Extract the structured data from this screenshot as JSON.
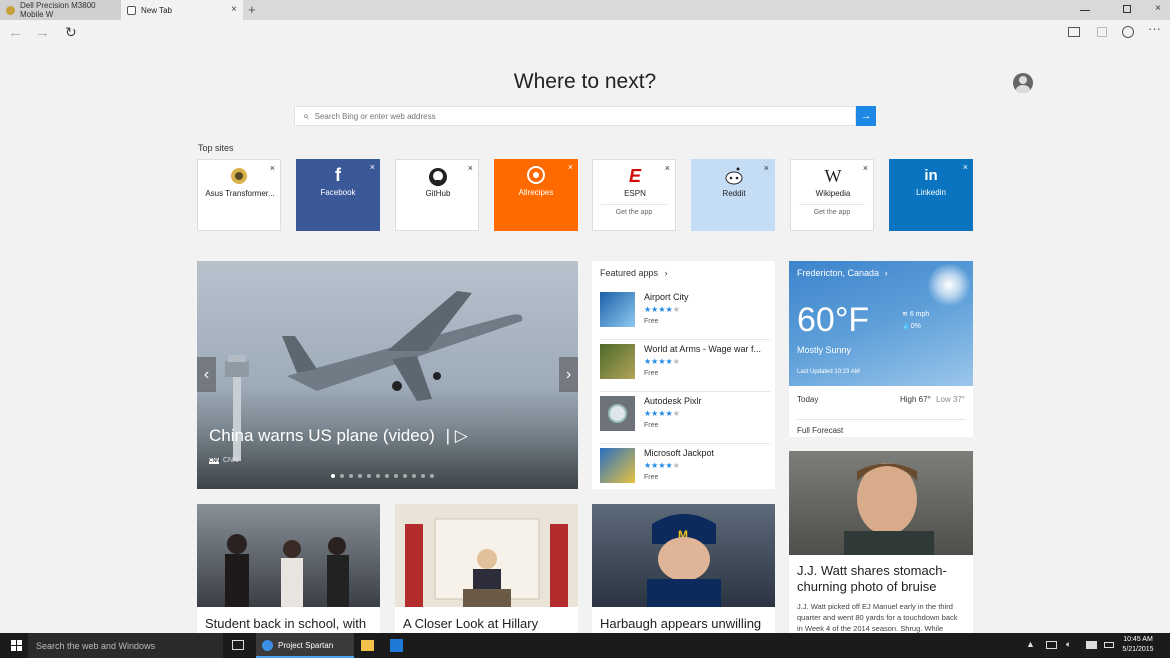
{
  "browser": {
    "tabs": [
      {
        "label": "Dell Precision M3800 Mobile W"
      },
      {
        "label": "New Tab"
      }
    ]
  },
  "icons": {
    "close": "×",
    "plus": "+",
    "back": "←",
    "forward": "→",
    "refresh": "↻",
    "search": "⌕",
    "go": "→",
    "prev": "‹",
    "next": "›",
    "chevron": "›",
    "play": "▷"
  },
  "newtab": {
    "headline": "Where to next?",
    "search_placeholder": "Search Bing or enter web address",
    "top_sites_label": "Top sites"
  },
  "top_sites": [
    {
      "name": "Asus Transformer...",
      "logo": "",
      "get_app": ""
    },
    {
      "name": "Facebook",
      "logo": "f",
      "get_app": ""
    },
    {
      "name": "GitHub",
      "logo": "",
      "get_app": ""
    },
    {
      "name": "Allrecipes",
      "logo": "",
      "get_app": ""
    },
    {
      "name": "ESPN",
      "logo": "E",
      "get_app": "Get the app"
    },
    {
      "name": "Reddit",
      "logo": "",
      "get_app": ""
    },
    {
      "name": "Wikipedia",
      "logo": "W",
      "get_app": "Get the app"
    },
    {
      "name": "Linkedin",
      "logo": "in",
      "get_app": ""
    }
  ],
  "colors": {
    "facebook": "#3b5998",
    "allrecipes": "#ff6a00",
    "reddit": "#c5dcf5",
    "linkedin": "#0a74c0",
    "accent": "#1e88e5",
    "espn": "#d50a0a"
  },
  "hero": {
    "caption": "China warns US plane (video)",
    "source_badge": "CNN",
    "source": "CNN"
  },
  "featured_apps": {
    "header": "Featured apps",
    "items": [
      {
        "name": "Airport City",
        "price": "Free",
        "rating": 4
      },
      {
        "name": "World at Arms - Wage war f...",
        "price": "Free",
        "rating": 4
      },
      {
        "name": "Autodesk Pixlr",
        "price": "Free",
        "rating": 4
      },
      {
        "name": "Microsoft Jackpot",
        "price": "Free",
        "rating": 4
      }
    ]
  },
  "weather": {
    "city": "Fredericton, Canada",
    "temp": "60°F",
    "condition": "Mostly Sunny",
    "wind": "6 mph",
    "precip": "0%",
    "updated": "Last Updated 10:23 AM",
    "today_label": "Today",
    "high": "High 67°",
    "low": "Low 37°",
    "full_forecast": "Full Forecast"
  },
  "news": [
    {
      "title": "Student back in school, with",
      "desc": ""
    },
    {
      "title": "A Closer Look at Hillary",
      "desc": ""
    },
    {
      "title": "Harbaugh appears unwilling to",
      "desc": ""
    },
    {
      "title": "J.J. Watt shares stomach-churning photo of bruise",
      "desc": "J.J. Watt picked off EJ Manuel early in the third quarter and went 80 yards for a touchdown back in Week 4 of the 2014 season. Shrug. While"
    }
  ],
  "taskbar": {
    "search_placeholder": "Search the web and Windows",
    "app_label": "Project Spartan",
    "tray": "▲",
    "store_letter": "",
    "time": "10:45 AM",
    "date": "5/21/2015"
  }
}
